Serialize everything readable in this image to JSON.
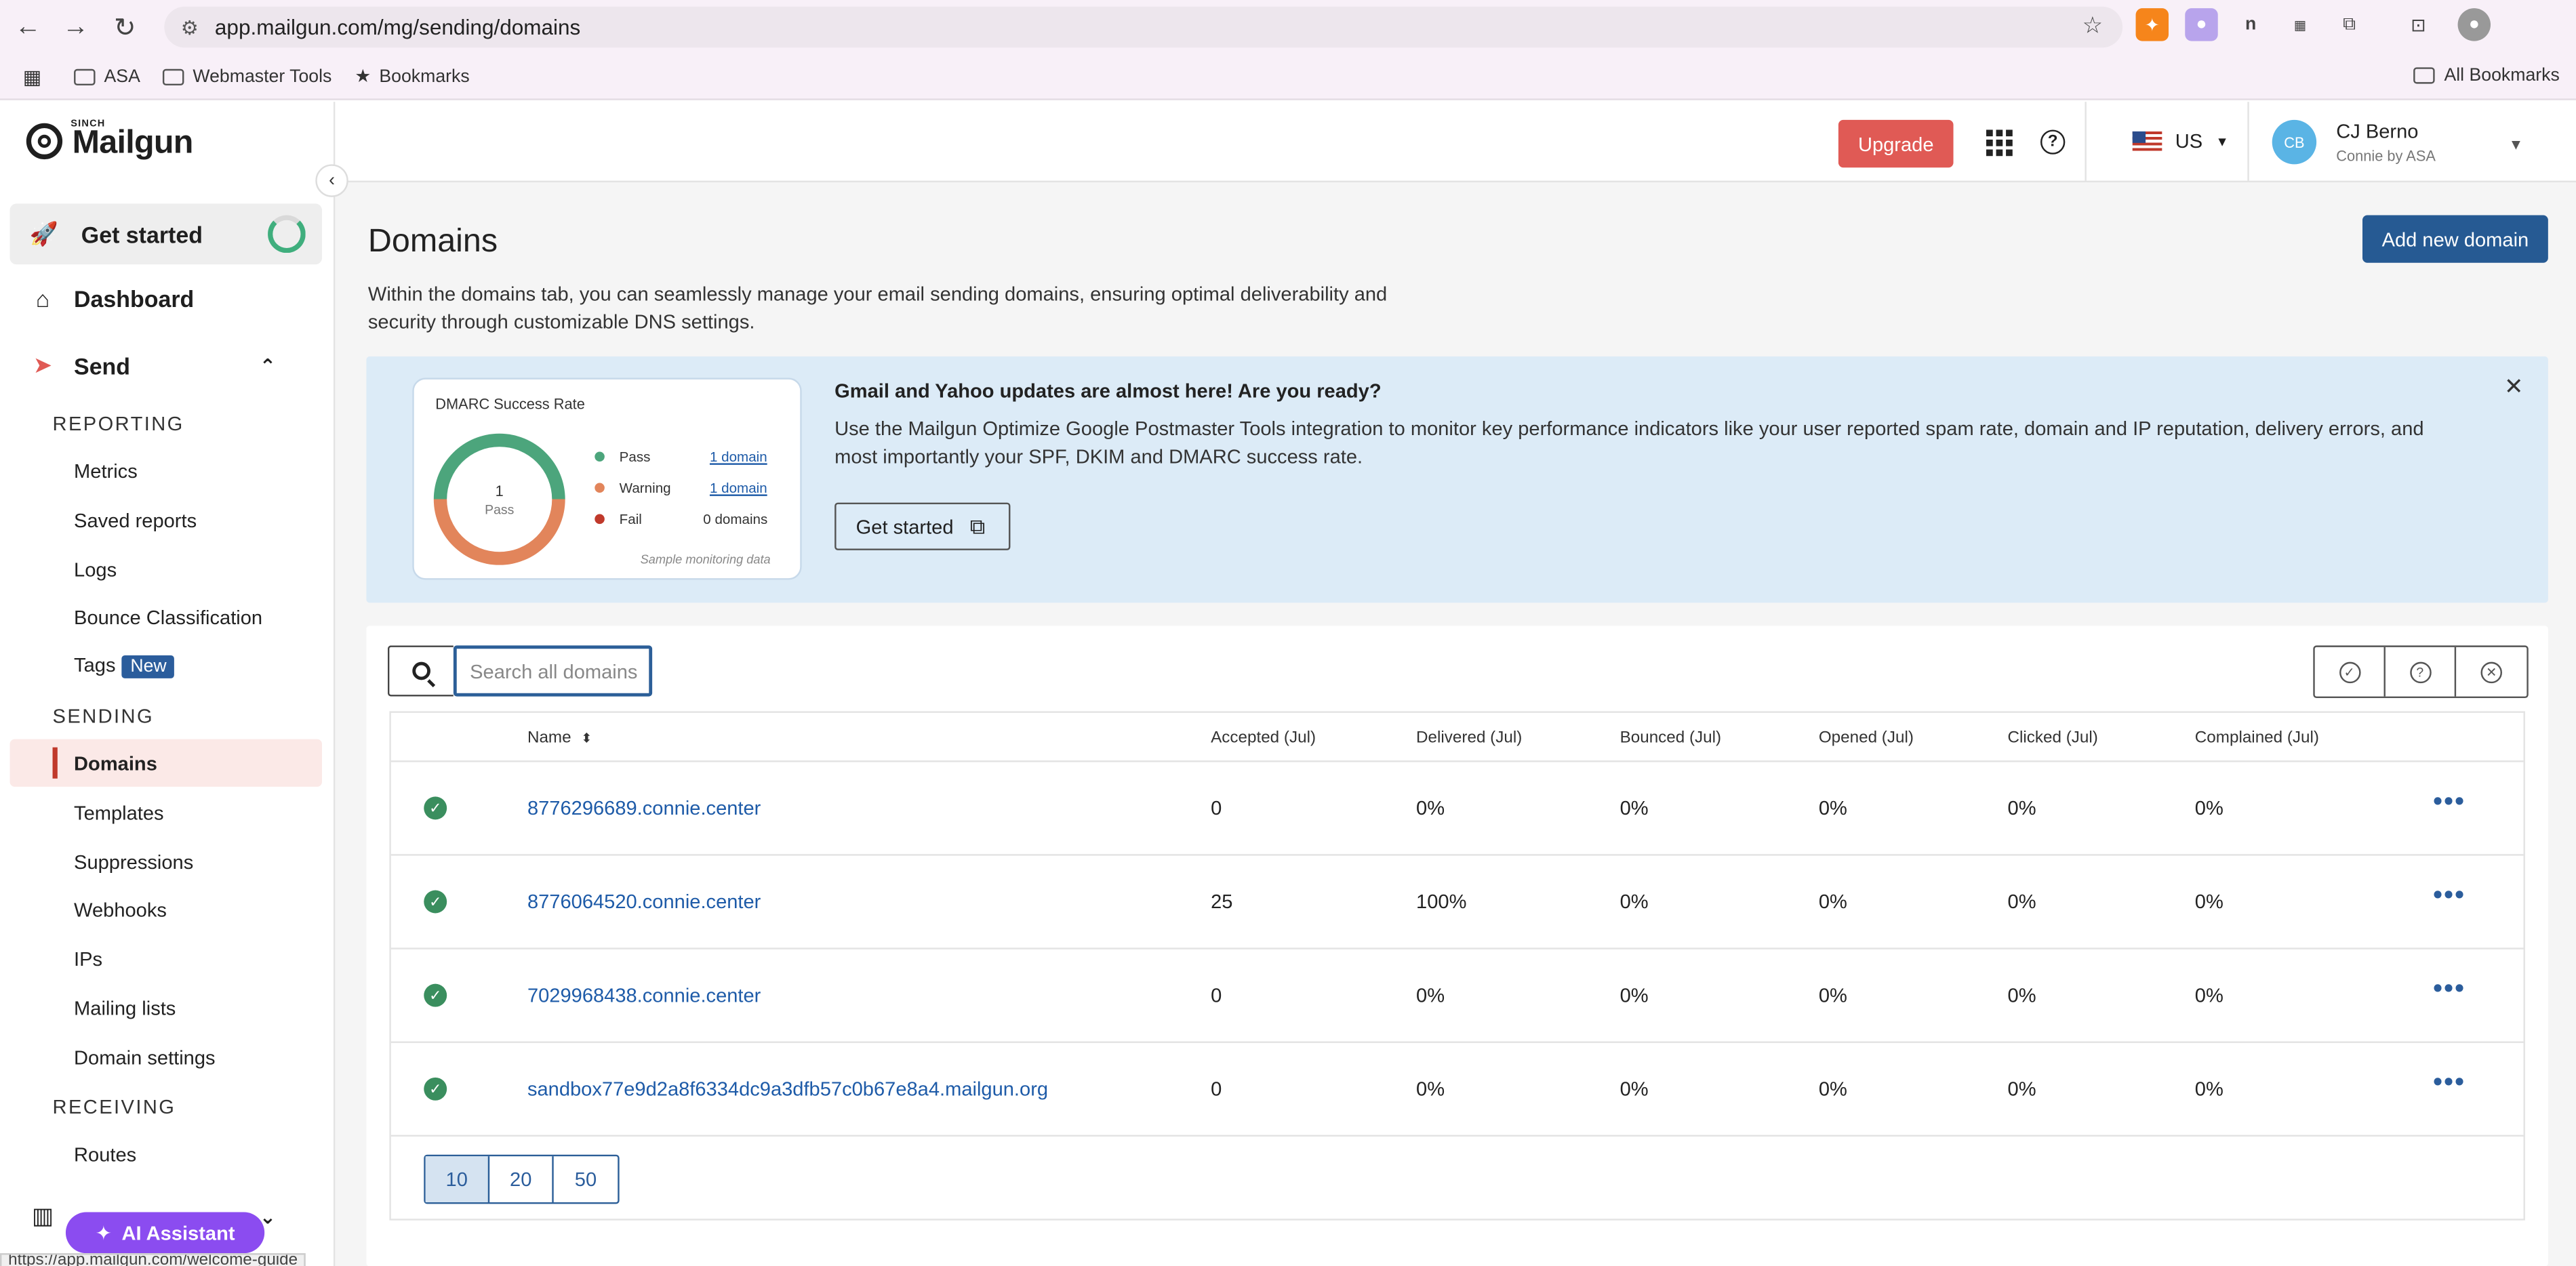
{
  "browser": {
    "url": "app.mailgun.com/mg/sending/domains",
    "bookmarks": [
      "ASA",
      "Webmaster Tools",
      "Bookmarks"
    ],
    "all_bookmarks": "All Bookmarks",
    "status_url": "https://app.mailgun.com/welcome-guide"
  },
  "sidebar": {
    "logo_sinch": "SINCH",
    "logo_text": "Mailgun",
    "get_started": "Get started",
    "dashboard": "Dashboard",
    "send": "Send",
    "reporting_heading": "REPORTING",
    "reporting_items": [
      "Metrics",
      "Saved reports",
      "Logs",
      "Bounce Classification",
      "Tags"
    ],
    "tags_badge": "New",
    "sending_heading": "SENDING",
    "sending_items": [
      "Domains",
      "Templates",
      "Suppressions",
      "Webhooks",
      "IPs",
      "Mailing lists",
      "Domain settings"
    ],
    "receiving_heading": "RECEIVING",
    "receiving_items": [
      "Routes"
    ],
    "ai_assistant": "AI Assistant"
  },
  "header": {
    "upgrade": "Upgrade",
    "region": "US",
    "avatar_initials": "CB",
    "user_name": "CJ Berno",
    "user_org": "Connie by ASA"
  },
  "page": {
    "title": "Domains",
    "add_button": "Add new domain",
    "description": "Within the domains tab, you can seamlessly manage your email sending domains, ensuring optimal deliverability and security through customizable DNS settings."
  },
  "banner": {
    "card_title": "DMARC Success Rate",
    "donut_value": "1",
    "donut_label": "Pass",
    "legend": [
      {
        "label": "Pass",
        "value": "1 domain",
        "color": "#4ca57c",
        "link": true
      },
      {
        "label": "Warning",
        "value": "1 domain",
        "color": "#e2855b",
        "link": true
      },
      {
        "label": "Fail",
        "value": "0 domains",
        "color": "#c0392b",
        "link": false
      }
    ],
    "sample_note": "Sample monitoring data",
    "heading": "Gmail and Yahoo updates are almost here! Are you ready?",
    "body": "Use the Mailgun Optimize Google Postmaster Tools integration to monitor key performance indicators like your user reported spam rate, domain and IP reputation, delivery errors, and most importantly your SPF, DKIM and DMARC success rate.",
    "button": "Get started"
  },
  "search": {
    "placeholder": "Search all domains"
  },
  "table": {
    "columns": {
      "name": "Name",
      "accepted": "Accepted (Jul)",
      "delivered": "Delivered (Jul)",
      "bounced": "Bounced (Jul)",
      "opened": "Opened (Jul)",
      "clicked": "Clicked (Jul)",
      "complained": "Complained (Jul)"
    },
    "rows": [
      {
        "name": "8776296689.connie.center",
        "accepted": "0",
        "delivered": "0%",
        "bounced": "0%",
        "opened": "0%",
        "clicked": "0%",
        "complained": "0%"
      },
      {
        "name": "8776064520.connie.center",
        "accepted": "25",
        "delivered": "100%",
        "bounced": "0%",
        "opened": "0%",
        "clicked": "0%",
        "complained": "0%"
      },
      {
        "name": "7029968438.connie.center",
        "accepted": "0",
        "delivered": "0%",
        "bounced": "0%",
        "opened": "0%",
        "clicked": "0%",
        "complained": "0%"
      },
      {
        "name": "sandbox77e9d2a8f6334dc9a3dfb57c0b67e8a4.mailgun.org",
        "accepted": "0",
        "delivered": "0%",
        "bounced": "0%",
        "opened": "0%",
        "clicked": "0%",
        "complained": "0%"
      }
    ],
    "page_sizes": [
      "10",
      "20",
      "50"
    ],
    "selected_page_size": "10"
  }
}
